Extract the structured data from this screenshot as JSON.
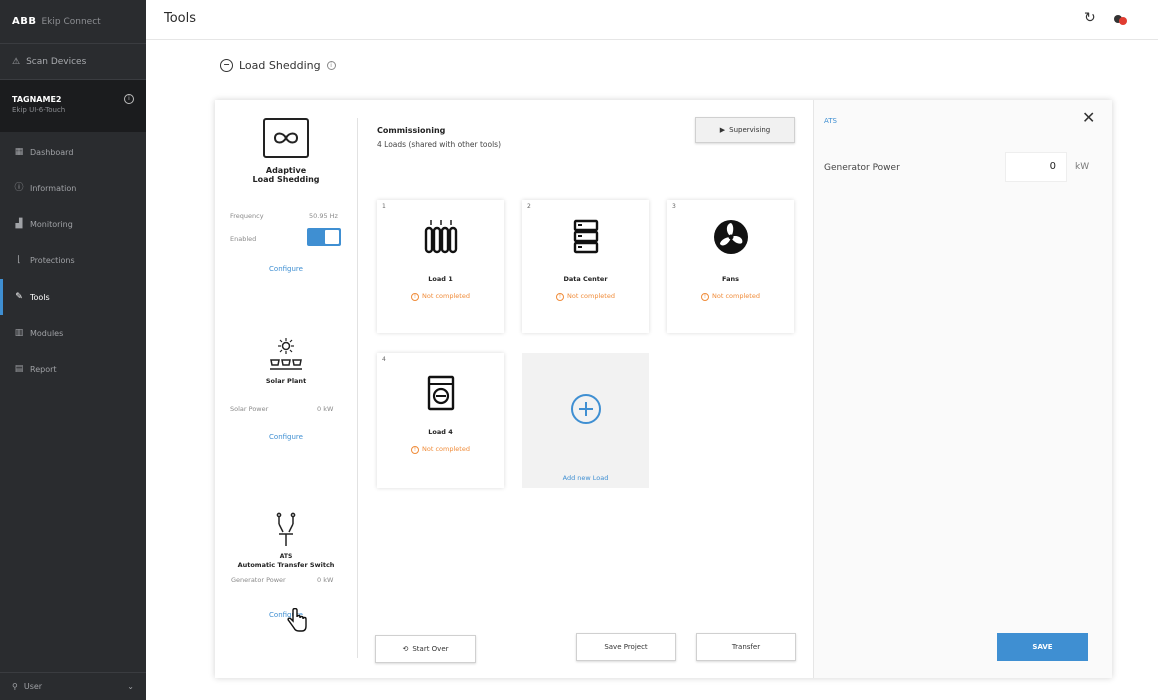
{
  "sidebar": {
    "brand": "ABB",
    "app_name": "Ekip Connect",
    "scan": "Scan Devices",
    "device_name": "TAGNAME2",
    "device_sub": "Ekip UI-6-Touch",
    "items": [
      {
        "label": "Dashboard",
        "icon": "dashboard-icon"
      },
      {
        "label": "Information",
        "icon": "info-icon"
      },
      {
        "label": "Monitoring",
        "icon": "chart-icon"
      },
      {
        "label": "Protections",
        "icon": "protection-icon"
      },
      {
        "label": "Tools",
        "icon": "tools-icon"
      },
      {
        "label": "Modules",
        "icon": "modules-icon"
      },
      {
        "label": "Report",
        "icon": "report-icon"
      }
    ],
    "user": "User"
  },
  "header": {
    "title": "Tools"
  },
  "section": {
    "title": "Load Shedding"
  },
  "left": {
    "adaptive_title_1": "Adaptive",
    "adaptive_title_2": "Load Shedding",
    "frequency_label": "Frequency",
    "frequency_value": "50.95 Hz",
    "enabled_label": "Enabled",
    "configure": "Configure",
    "solar_title": "Solar Plant",
    "solar_power_label": "Solar Power",
    "solar_power_value": "0 kW",
    "ats_short": "ATS",
    "ats_title": "Automatic Transfer Switch",
    "ats_gen_label": "Generator Power",
    "ats_gen_value": "0 kW"
  },
  "mid": {
    "title": "Commissioning",
    "subtitle": "4 Loads (shared with other tools)",
    "supervising": "Supervising",
    "loads": [
      {
        "num": "1",
        "name": "Load 1",
        "status": "Not completed"
      },
      {
        "num": "2",
        "name": "Data Center",
        "status": "Not completed"
      },
      {
        "num": "3",
        "name": "Fans",
        "status": "Not completed"
      },
      {
        "num": "4",
        "name": "Load 4",
        "status": "Not completed"
      }
    ],
    "add_load": "Add new Load",
    "start_over": "Start Over",
    "save_project": "Save Project",
    "transfer": "Transfer"
  },
  "right": {
    "title": "ATS",
    "generator_power_label": "Generator Power",
    "generator_power_value": "0",
    "unit": "kW",
    "save": "SAVE"
  },
  "colors": {
    "accent": "#3f8fd2",
    "warning": "#f08c3a",
    "sidebar": "#2a2c2f"
  }
}
